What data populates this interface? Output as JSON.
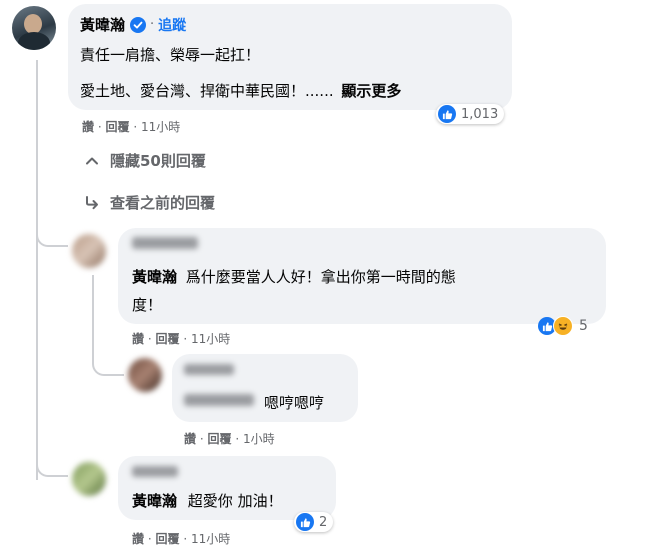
{
  "main_comment": {
    "author": "黃暐瀚",
    "follow_label": "追蹤",
    "line1": "責任一肩擔、榮辱一起扛！",
    "line2": "愛土地、愛台灣、捍衛中華民國！......",
    "see_more": "顯示更多",
    "reaction_count": "1,013",
    "like": "讚",
    "reply": "回覆",
    "time": "11小時"
  },
  "hide_replies": "隱藏50則回覆",
  "view_previous": "查看之前的回覆",
  "replies": [
    {
      "mention": "黃暐瀚",
      "text_a": "爲什麼要當人人好！拿出你第一時間的態",
      "text_b": "度！",
      "reaction_count": "5",
      "like": "讚",
      "reply": "回覆",
      "time": "11小時"
    },
    {
      "text": "嗯哼嗯哼",
      "like": "讚",
      "reply": "回覆",
      "time": "1小時"
    },
    {
      "mention": "黃暐瀚",
      "text": "超愛你 加油！",
      "reaction_count": "2",
      "like": "讚",
      "reply": "回覆",
      "time": "11小時"
    }
  ],
  "colors": {
    "bubble": "#f0f2f5",
    "like_blue": "#1877f2",
    "meta_gray": "#65676b",
    "haha_yellow": "#f7b125"
  },
  "icons": [
    "verified-badge-icon",
    "chevron-up-icon",
    "reply-arrow-icon",
    "like-icon",
    "haha-icon"
  ]
}
